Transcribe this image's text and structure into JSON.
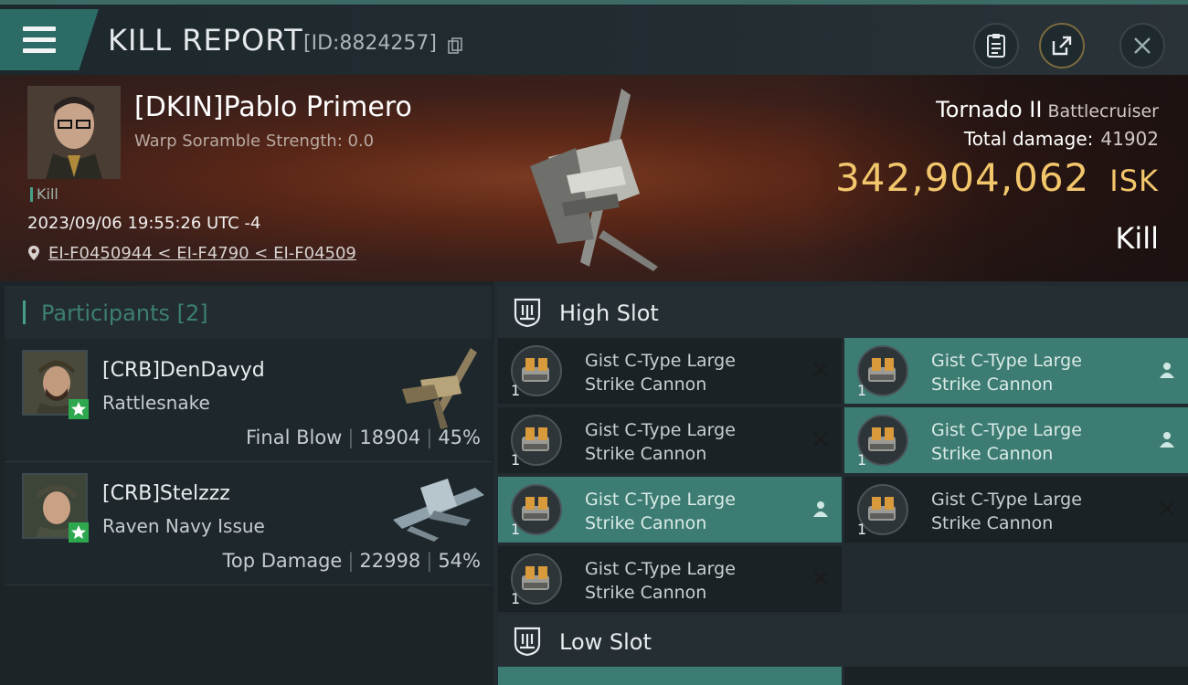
{
  "header": {
    "title": "KILL REPORT",
    "report_id": "[ID:8824257]"
  },
  "victim": {
    "name": "[DKIN]Pablo Primero",
    "warp_scramble": "Warp Soramble Strength: 0.0",
    "tag": "Kill",
    "timestamp": "2023/09/06 19:55:26 UTC -4",
    "location": "EI-F0450944 < EI-F4790 < EI-F04509",
    "ship": "Tornado II",
    "ship_class": "Battlecruiser",
    "total_damage_label": "Total damage:",
    "total_damage": "41902",
    "isk_value": "342,904,062",
    "isk_unit": "ISK",
    "result": "Kill"
  },
  "participants": {
    "label": "Participants",
    "count": "[2]",
    "items": [
      {
        "name": "[CRB]DenDavyd",
        "ship": "Rattlesnake",
        "role": "Final Blow",
        "damage": "18904",
        "percent": "45%"
      },
      {
        "name": "[CRB]Stelzzz",
        "ship": "Raven Navy Issue",
        "role": "Top Damage",
        "damage": "22998",
        "percent": "54%"
      }
    ]
  },
  "high_slot": {
    "label": "High Slot",
    "modules": [
      {
        "name_line1": "Gist C-Type Large",
        "name_line2": "Strike Cannon",
        "qty": "1",
        "status": "destroyed"
      },
      {
        "name_line1": "Gist C-Type Large",
        "name_line2": "Strike Cannon",
        "qty": "1",
        "status": "dropped"
      },
      {
        "name_line1": "Gist C-Type Large",
        "name_line2": "Strike Cannon",
        "qty": "1",
        "status": "destroyed"
      },
      {
        "name_line1": "Gist C-Type Large",
        "name_line2": "Strike Cannon",
        "qty": "1",
        "status": "dropped"
      },
      {
        "name_line1": "Gist C-Type Large",
        "name_line2": "Strike Cannon",
        "qty": "1",
        "status": "dropped"
      },
      {
        "name_line1": "Gist C-Type Large",
        "name_line2": "Strike Cannon",
        "qty": "1",
        "status": "destroyed"
      },
      {
        "name_line1": "Gist C-Type Large",
        "name_line2": "Strike Cannon",
        "qty": "1",
        "status": "destroyed"
      }
    ]
  },
  "low_slot": {
    "label": "Low Slot"
  },
  "colors": {
    "accent_teal": "#3c7c72",
    "isk_gold": "#f2c66b",
    "kill_red": "#5a2717"
  },
  "icons": [
    "menu-icon",
    "copy-icon",
    "clipboard-icon",
    "share-icon",
    "close-icon",
    "location-pin-icon",
    "slot-icon",
    "x-icon",
    "person-icon",
    "star-icon"
  ]
}
